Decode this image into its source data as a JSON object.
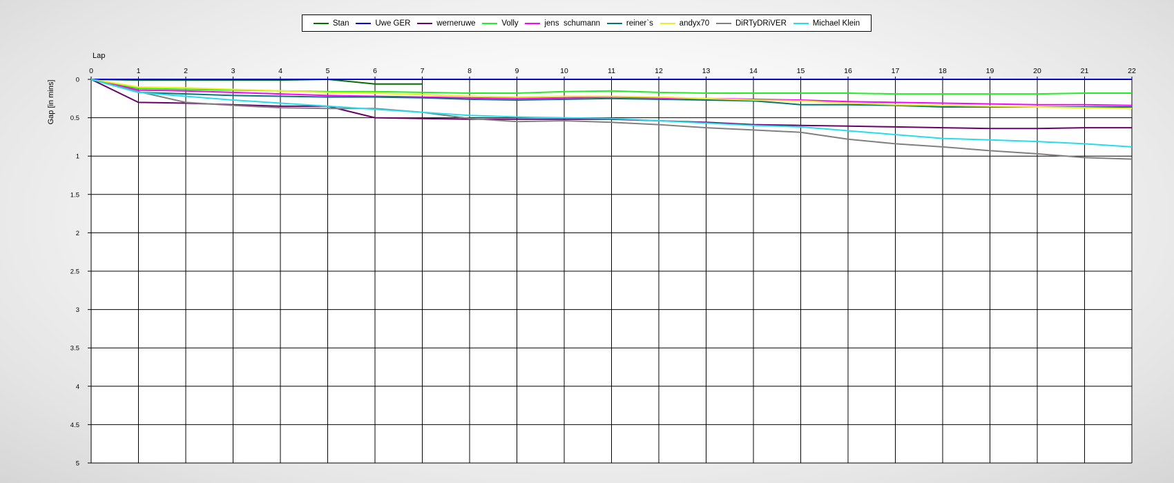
{
  "chart_data": {
    "type": "line",
    "xlabel": "Lap",
    "ylabel": "Gap [in mins]",
    "x": [
      0,
      1,
      2,
      3,
      4,
      5,
      6,
      7,
      8,
      9,
      10,
      11,
      12,
      13,
      14,
      15,
      16,
      17,
      18,
      19,
      20,
      21,
      22
    ],
    "xlim": [
      0,
      22
    ],
    "ylim": [
      0,
      5
    ],
    "y_inverted": true,
    "x_axis_position": "top",
    "yticks": [
      "0",
      "0.5",
      "1",
      "1.5",
      "2",
      "2.5",
      "3",
      "3.5",
      "4",
      "4.5",
      "5"
    ],
    "grid": true,
    "legend_position": "top-center",
    "series": [
      {
        "name": "Stan",
        "color": "#007000",
        "values": [
          0,
          0.01,
          0.01,
          0.01,
          0.01,
          0,
          0.06,
          0.06
        ]
      },
      {
        "name": "Uwe GER",
        "color": "#0000dd",
        "values": [
          0,
          0,
          0,
          0,
          0,
          0,
          0,
          0,
          0,
          0,
          0,
          0,
          0,
          0,
          0,
          0,
          0,
          0,
          0,
          0,
          0,
          0,
          0
        ]
      },
      {
        "name": "werneruwe",
        "color": "#6a006a",
        "values": [
          0,
          0.3,
          0.31,
          0.33,
          0.35,
          0.35,
          0.5,
          0.51,
          0.52,
          0.52,
          0.52,
          0.52,
          0.54,
          0.56,
          0.59,
          0.6,
          0.61,
          0.62,
          0.63,
          0.64,
          0.64,
          0.63,
          0.63
        ]
      },
      {
        "name": "Volly",
        "color": "#22ee22",
        "values": [
          0,
          0.12,
          0.13,
          0.14,
          0.15,
          0.16,
          0.16,
          0.17,
          0.18,
          0.18,
          0.16,
          0.15,
          0.17,
          0.18,
          0.18,
          0.18,
          0.18,
          0.19,
          0.19,
          0.19,
          0.19,
          0.18,
          0.18
        ]
      },
      {
        "name": "jens  schumann",
        "color": "#ff00ff",
        "values": [
          0,
          0.14,
          0.15,
          0.17,
          0.19,
          0.21,
          0.22,
          0.23,
          0.24,
          0.25,
          0.24,
          0.23,
          0.24,
          0.25,
          0.26,
          0.27,
          0.29,
          0.3,
          0.31,
          0.32,
          0.33,
          0.33,
          0.34
        ]
      },
      {
        "name": "reiner`s",
        "color": "#007777",
        "values": [
          0,
          0.17,
          0.19,
          0.21,
          0.22,
          0.23,
          0.23,
          0.24,
          0.26,
          0.27,
          0.26,
          0.25,
          0.26,
          0.27,
          0.28,
          0.33,
          0.33,
          0.34,
          0.36,
          0.36,
          0.36,
          0.36,
          0.36
        ]
      },
      {
        "name": "andyx70",
        "color": "#eeee22",
        "values": [
          0,
          0.1,
          0.11,
          0.13,
          0.15,
          0.17,
          0.18,
          0.2,
          0.22,
          0.23,
          0.22,
          0.22,
          0.23,
          0.25,
          0.27,
          0.28,
          0.31,
          0.33,
          0.34,
          0.35,
          0.36,
          0.37,
          0.38
        ]
      },
      {
        "name": "DiRTyDRiVER",
        "color": "#808080",
        "values": [
          0,
          0.16,
          0.3,
          0.34,
          0.37,
          0.38,
          0.38,
          0.43,
          0.51,
          0.55,
          0.54,
          0.56,
          0.59,
          0.63,
          0.66,
          0.69,
          0.78,
          0.84,
          0.88,
          0.93,
          0.97,
          1.02,
          1.04
        ]
      },
      {
        "name": "Michael Klein",
        "color": "#22ddee",
        "values": [
          0,
          0.17,
          0.22,
          0.27,
          0.31,
          0.35,
          0.39,
          0.43,
          0.47,
          0.49,
          0.5,
          0.51,
          0.54,
          0.57,
          0.6,
          0.62,
          0.67,
          0.72,
          0.77,
          0.79,
          0.81,
          0.84,
          0.88
        ]
      }
    ]
  }
}
